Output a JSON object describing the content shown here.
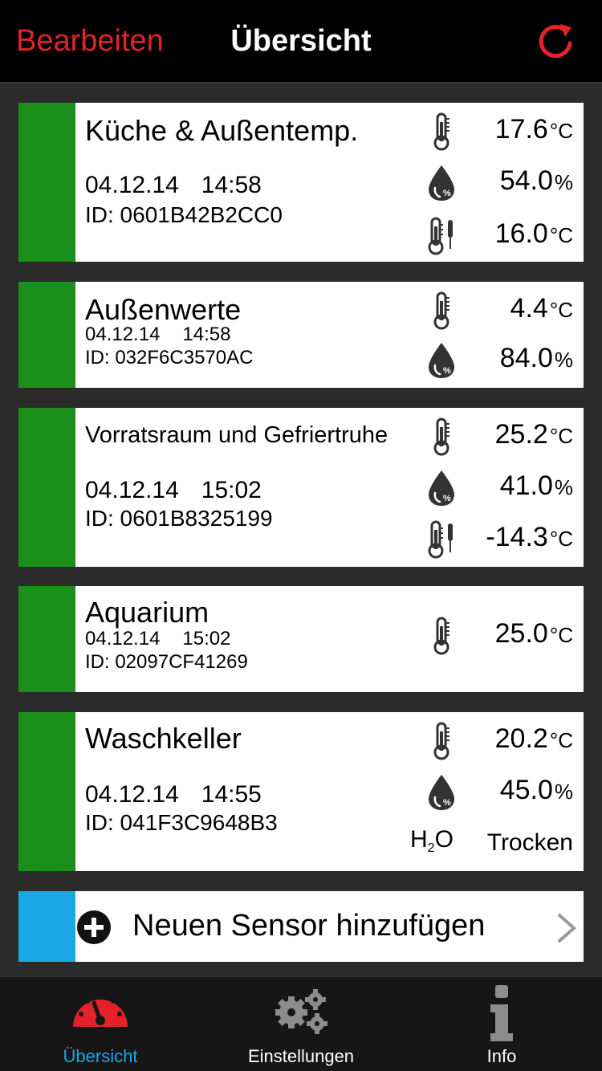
{
  "colors": {
    "accent_red": "#e5222a",
    "status_green": "#1a8f1a",
    "add_blue": "#1aa7e6",
    "tab_active": "#1aa7e6"
  },
  "nav": {
    "edit_label": "Bearbeiten",
    "title": "Übersicht",
    "refresh_icon": "refresh-icon"
  },
  "sensors": [
    {
      "name": "Küche & Außentemp.",
      "date": "04.12.14",
      "time": "14:58",
      "id": "ID: 0601B42B2CC0",
      "readings": [
        {
          "icon": "thermometer-icon",
          "value": "17.6",
          "unit": "°C"
        },
        {
          "icon": "humidity-drop-icon",
          "value": "54.0",
          "unit": "%"
        },
        {
          "icon": "probe-thermometer-icon",
          "value": "16.0",
          "unit": "°C"
        }
      ]
    },
    {
      "name": "Außenwerte",
      "date": "04.12.14",
      "time": "14:58",
      "id": "ID: 032F6C3570AC",
      "readings": [
        {
          "icon": "thermometer-icon",
          "value": "4.4",
          "unit": "°C"
        },
        {
          "icon": "humidity-drop-icon",
          "value": "84.0",
          "unit": "%"
        }
      ]
    },
    {
      "name": "Vorratsraum und Gefriertruhe",
      "date": "04.12.14",
      "time": "15:02",
      "id": "ID: 0601B8325199",
      "readings": [
        {
          "icon": "thermometer-icon",
          "value": "25.2",
          "unit": "°C"
        },
        {
          "icon": "humidity-drop-icon",
          "value": "41.0",
          "unit": "%"
        },
        {
          "icon": "probe-thermometer-icon",
          "value": "-14.3",
          "unit": "°C"
        }
      ]
    },
    {
      "name": "Aquarium",
      "date": "04.12.14",
      "time": "15:02",
      "id": "ID: 02097CF41269",
      "readings": [
        {
          "icon": "thermometer-icon",
          "value": "25.0",
          "unit": "°C"
        }
      ]
    },
    {
      "name": "Waschkeller",
      "date": "04.12.14",
      "time": "14:55",
      "id": "ID: 041F3C9648B3",
      "readings": [
        {
          "icon": "thermometer-icon",
          "value": "20.2",
          "unit": "°C"
        },
        {
          "icon": "humidity-drop-icon",
          "value": "45.0",
          "unit": "%"
        }
      ],
      "water": {
        "label_main": "H",
        "label_sub": "2",
        "label_end": "O",
        "status": "Trocken"
      }
    }
  ],
  "add_sensor": {
    "label": "Neuen Sensor hinzufügen",
    "icon": "plus-circle-icon"
  },
  "tabs": [
    {
      "label": "Übersicht",
      "icon": "gauge-icon",
      "active": true
    },
    {
      "label": "Einstellungen",
      "icon": "gears-icon",
      "active": false
    },
    {
      "label": "Info",
      "icon": "info-icon",
      "active": false
    }
  ]
}
